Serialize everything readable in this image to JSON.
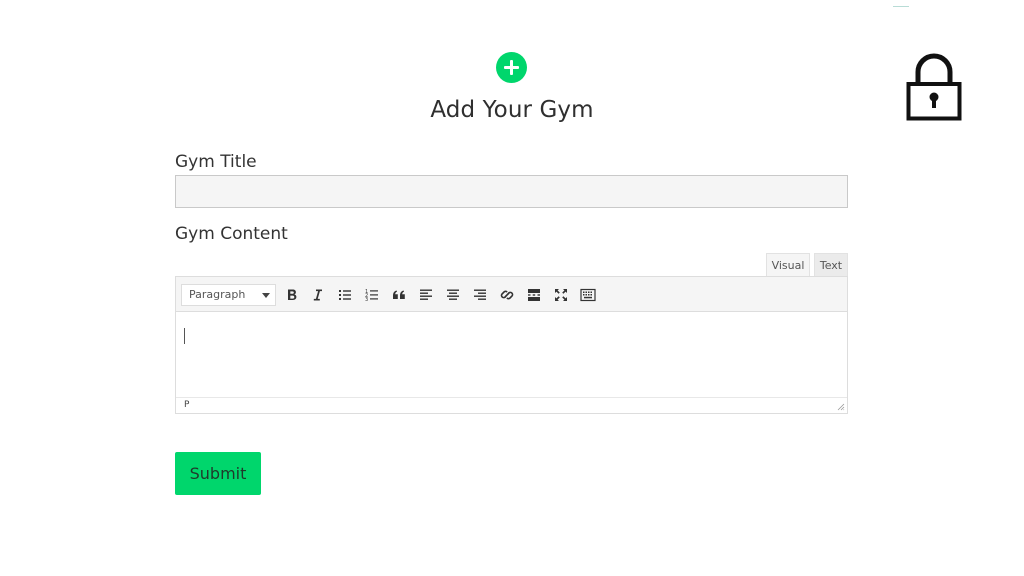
{
  "form": {
    "heading": "Add Your Gym",
    "title_label": "Gym Title",
    "title_value": "",
    "title_placeholder": "",
    "content_label": "Gym Content",
    "submit_label": "Submit"
  },
  "editor": {
    "tabs": [
      {
        "label": "Visual",
        "active": true
      },
      {
        "label": "Text",
        "active": false
      }
    ],
    "format_select": "Paragraph",
    "toolbar": [
      "bold-icon",
      "italic-icon",
      "bulleted-list-icon",
      "numbered-list-icon",
      "blockquote-icon",
      "align-left-icon",
      "align-center-icon",
      "align-right-icon",
      "link-icon",
      "read-more-icon",
      "fullscreen-icon",
      "keyboard-icon"
    ],
    "content": "",
    "path": "P"
  },
  "icons": {
    "add": "plus-circle-icon",
    "lock": "lock-icon"
  },
  "colors": {
    "accent": "#00d66c",
    "text": "#333333",
    "input_bg": "#f5f5f5",
    "toolbar_bg": "#f5f5f5",
    "lock": "#111111"
  }
}
